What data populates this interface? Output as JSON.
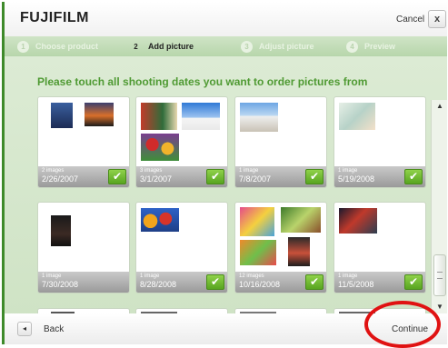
{
  "header": {
    "logo": "FUJIFILM",
    "cancel_label": "Cancel",
    "close_glyph": "x"
  },
  "steps": [
    {
      "number": "1",
      "label": "Choose product",
      "active": false
    },
    {
      "number": "2",
      "label": "Add picture",
      "active": true
    },
    {
      "number": "3",
      "label": "Adjust picture",
      "active": false
    },
    {
      "number": "4",
      "label": "Preview",
      "active": false
    }
  ],
  "instruction": "Please touch all shooting dates you want to order pictures from",
  "tiles": [
    {
      "count": "2 images",
      "date": "2/26/2007",
      "checked": true
    },
    {
      "count": "3 images",
      "date": "3/1/2007",
      "checked": true
    },
    {
      "count": "1 image",
      "date": "7/8/2007",
      "checked": true
    },
    {
      "count": "1 image",
      "date": "5/19/2008",
      "checked": true
    },
    {
      "count": "1 image",
      "date": "7/30/2008",
      "checked": false
    },
    {
      "count": "1 image",
      "date": "8/28/2008",
      "checked": true
    },
    {
      "count": "12 images",
      "date": "10/16/2008",
      "checked": true
    },
    {
      "count": "1 image",
      "date": "11/5/2008",
      "checked": true
    }
  ],
  "check_glyph": "✔",
  "footer": {
    "back_glyph": "◂",
    "back_label": "Back",
    "continue_label": "Continue"
  },
  "scrollbar": {
    "up_glyph": "▲",
    "down_glyph": "▼"
  },
  "colors": {
    "accent_green": "#4f9a33",
    "check_green": "#58a520",
    "highlight_red": "#e01212"
  }
}
